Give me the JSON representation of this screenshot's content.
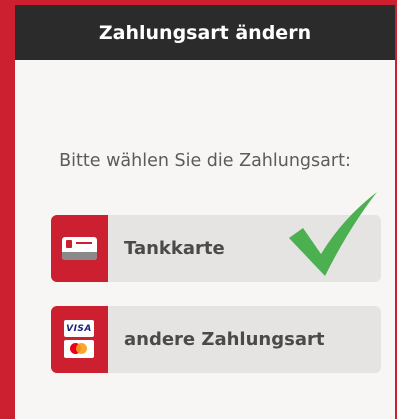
{
  "header": {
    "title": "Zahlungsart ändern"
  },
  "prompt": "Bitte wählen Sie die Zahlungsart:",
  "options": [
    {
      "label": "Tankkarte",
      "icon": "fuel-card-icon",
      "selected": true
    },
    {
      "label": "andere Zahlungsart",
      "icon": "credit-cards-icon",
      "selected": false
    }
  ],
  "icons": {
    "visa_text": "VISA"
  },
  "colors": {
    "accent": "#cc1f2f",
    "header_bg": "#2b2b2b",
    "option_bg": "#e6e4e2",
    "check": "#4caf50"
  }
}
